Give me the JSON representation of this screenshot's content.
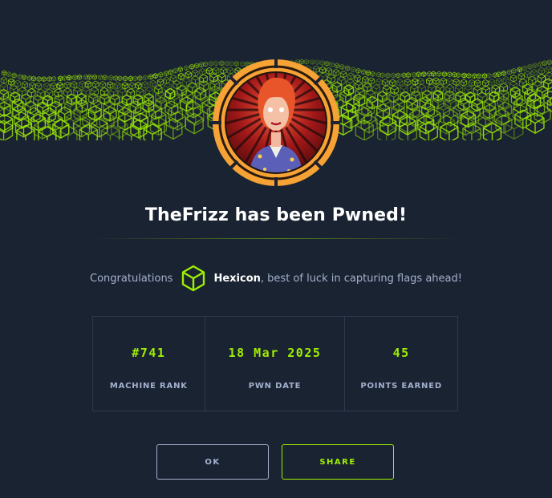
{
  "dialog": {
    "title": "TheFrizz has been Pwned!",
    "congrats_prefix": "Congratulations",
    "username": "Hexicon",
    "congrats_suffix": ", best of luck in capturing flags ahead!"
  },
  "stats": [
    {
      "value": "#741",
      "label": "MACHINE RANK"
    },
    {
      "value": "18 Mar 2025",
      "label": "PWN DATE"
    },
    {
      "value": "45",
      "label": "POINTS EARNED"
    }
  ],
  "buttons": {
    "ok_label": "OK",
    "share_label": "SHARE"
  },
  "icons": {
    "user_badge": "green-cube-icon",
    "machine_avatar": "machine-avatar"
  },
  "colors": {
    "background": "#1a2332",
    "accent": "#9fef00",
    "muted_text": "#a4b1cd",
    "avatar_ring": "#f7a234"
  }
}
